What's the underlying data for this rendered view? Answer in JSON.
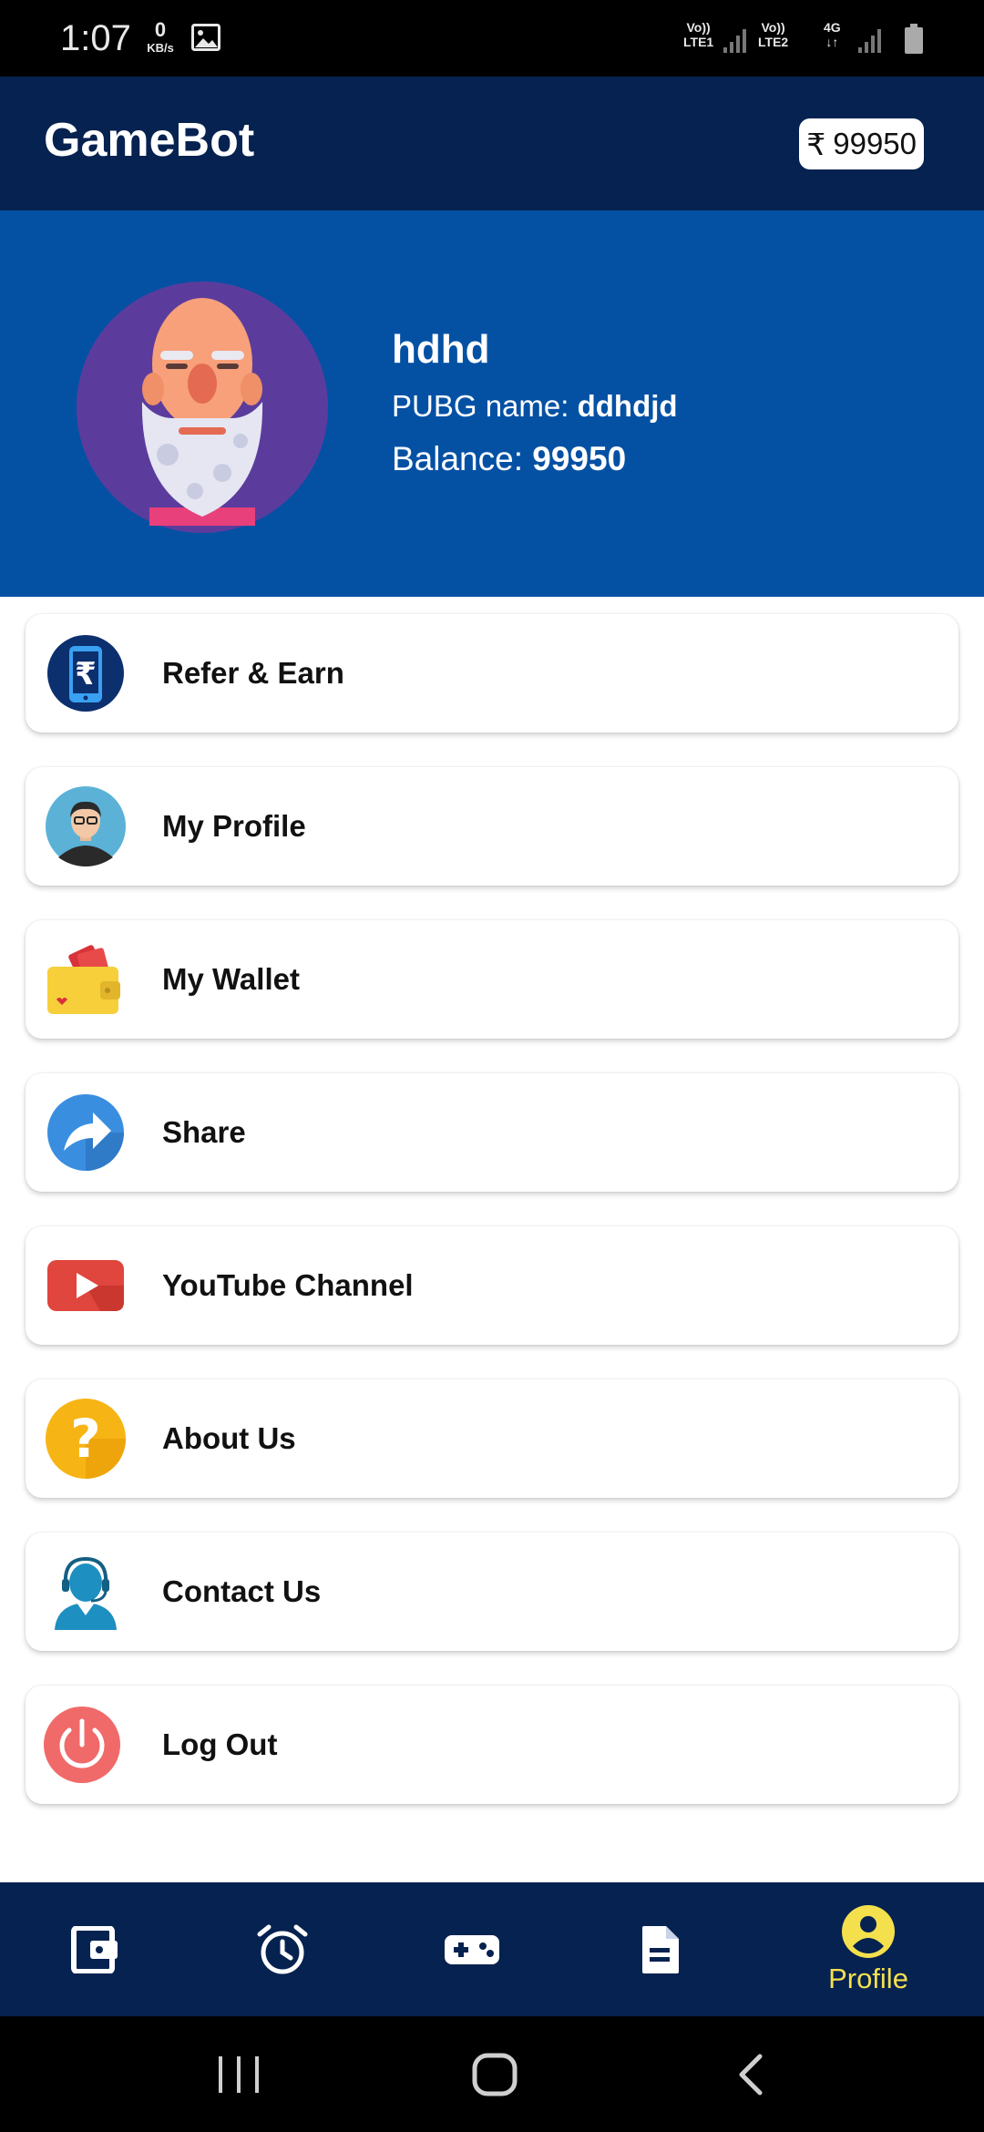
{
  "status_bar": {
    "time": "1:07",
    "kbs_value": "0",
    "kbs_unit": "KB/s",
    "sim1_top": "Vo))",
    "sim1_bottom": "LTE1",
    "sim2_top": "Vo))",
    "sim2_bottom": "LTE2",
    "network": "4G"
  },
  "app_bar": {
    "title": "GameBot",
    "balance_symbol": "₹",
    "balance": "99950"
  },
  "profile": {
    "username": "hdhd",
    "pubg_label": "PUBG name:",
    "pubg_name": "ddhdjd",
    "balance_label": "Balance:",
    "balance_value": "99950"
  },
  "menu": [
    {
      "label": "Refer & Earn",
      "icon": "rupee-phone-icon"
    },
    {
      "label": "My Profile",
      "icon": "user-avatar-icon"
    },
    {
      "label": "My Wallet",
      "icon": "wallet-icon"
    },
    {
      "label": "Share",
      "icon": "share-icon"
    },
    {
      "label": "YouTube Channel",
      "icon": "youtube-icon"
    },
    {
      "label": "About Us",
      "icon": "question-icon"
    },
    {
      "label": "Contact Us",
      "icon": "headset-support-icon"
    },
    {
      "label": "Log Out",
      "icon": "power-icon"
    }
  ],
  "bottom_nav": {
    "items": [
      "wallet-icon",
      "alarm-clock-icon",
      "gamepad-icon",
      "document-icon",
      "profile-icon"
    ],
    "active_label": "Profile"
  },
  "colors": {
    "appbar": "#062250",
    "header": "#0451a4",
    "active_nav": "#f4e04d"
  }
}
